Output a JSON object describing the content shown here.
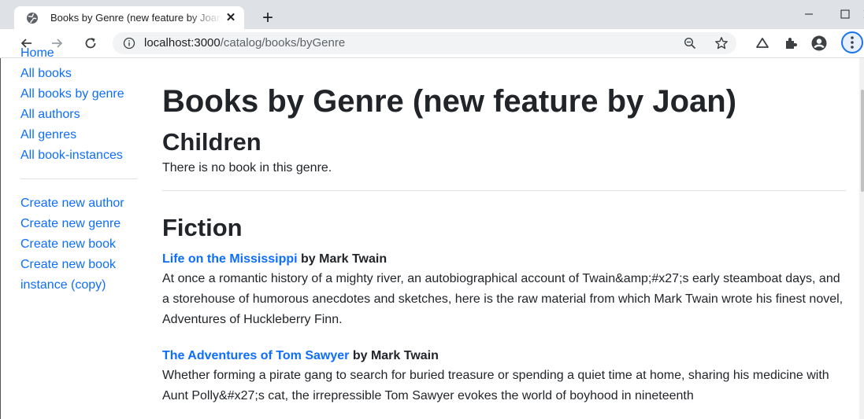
{
  "browser": {
    "tab_title": "Books by Genre (new feature by Joan)",
    "url_host": "localhost:3000",
    "url_path": "/catalog/books/byGenre"
  },
  "sidebar": {
    "nav": [
      {
        "label": "Home"
      },
      {
        "label": "All books"
      },
      {
        "label": "All books by genre"
      },
      {
        "label": "All authors"
      },
      {
        "label": "All genres"
      },
      {
        "label": "All book-instances"
      }
    ],
    "create": [
      {
        "label": "Create new author"
      },
      {
        "label": "Create new genre"
      },
      {
        "label": "Create new book"
      },
      {
        "label": "Create new book instance (copy)"
      }
    ]
  },
  "main": {
    "title": "Books by Genre (new feature by Joan)",
    "genres": [
      {
        "name": "Children",
        "empty_text": "There is no book in this genre."
      },
      {
        "name": "Fiction",
        "books": [
          {
            "title": "Life on the Mississippi",
            "by": " by Mark Twain",
            "summary": "At once a romantic history of a mighty river, an autobiographical account of Twain&amp;#x27;s early steamboat days, and a storehouse of humorous anecdotes and sketches, here is the raw material from which Mark Twain wrote his finest novel, Adventures of Huckleberry Finn."
          },
          {
            "title": "The Adventures of Tom Sawyer",
            "by": " by Mark Twain",
            "summary": "Whether forming a pirate gang to search for buried treasure or spending a quiet time at home, sharing his medicine with Aunt Polly&#x27;s cat, the irrepressible Tom Sawyer evokes the world of boyhood in nineteenth"
          }
        ]
      }
    ]
  },
  "colors": {
    "link": "#0d6efd",
    "text": "#212529",
    "chrome_tabbar": "#dee1e6"
  },
  "icons": [
    "globe-icon",
    "close-icon",
    "plus-icon",
    "minimize-icon",
    "maximize-icon",
    "window-close-icon",
    "back-icon",
    "forward-icon",
    "reload-icon",
    "info-icon",
    "zoom-out-icon",
    "star-icon",
    "cloud-icon",
    "puzzle-icon",
    "profile-icon",
    "menu-icon"
  ]
}
